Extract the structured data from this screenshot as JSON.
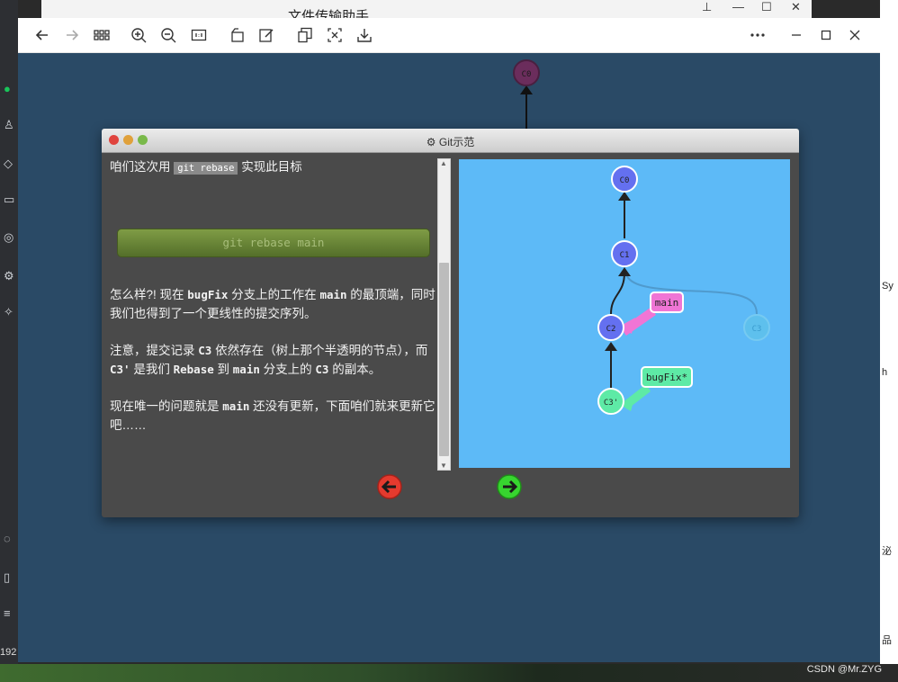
{
  "background": {
    "back_window_title": "文件传输助手",
    "right_edge_texts": [
      "Sy",
      "h",
      "泌",
      "品"
    ],
    "left_edge_text": "192",
    "watermark": "CSDN @Mr.ZYG"
  },
  "viewer": {
    "toolbar": [
      "back-icon",
      "forward-icon",
      "grid-icon",
      "zoom-in-icon",
      "zoom-out-icon",
      "actual-size-icon",
      "rotate-icon",
      "edit-icon",
      "copy-icon",
      "crop-icon",
      "save-icon",
      "more-icon",
      "minimize-icon",
      "maximize-icon",
      "close-icon"
    ]
  },
  "outer_tree": {
    "root_label": "C0"
  },
  "dialog": {
    "title": "Git示范",
    "colors": {
      "close": "#e0443e",
      "minimize": "#e0a13b",
      "zoom": "#79b94a"
    },
    "intro_prefix": "咱们这次用",
    "intro_badge": "git rebase",
    "intro_suffix": "实现此目标",
    "command": "git rebase main",
    "p1": {
      "a": "怎么样?! 现在 ",
      "b": "bugFix",
      "c": " 分支上的工作在 ",
      "d": "main",
      "e": " 的最顶端，同时我们也得到了一个更线性的提交序列。"
    },
    "p2": {
      "a": "注意，提交记录 ",
      "b": "C3",
      "c": " 依然存在（树上那个半透明的节点），而 ",
      "d": "C3'",
      "e": " 是我们 ",
      "f": "Rebase",
      "g": " 到 ",
      "h": "main",
      "i": " 分支上的 ",
      "j": "C3",
      "k": " 的副本。"
    },
    "p3": {
      "a": "现在唯一的问题就是 ",
      "b": "main",
      "c": " 还没有更新，下面咱们就来更新它吧……"
    }
  },
  "git_tree": {
    "commits": [
      "C0",
      "C1",
      "C2",
      "C3",
      "C3'"
    ],
    "branches": [
      {
        "name": "main",
        "target": "C2",
        "color": "#f075d5"
      },
      {
        "name": "bugFix*",
        "target": "C3'",
        "color": "#5eeaa6"
      }
    ],
    "colors": {
      "commit": "#6470f0",
      "head": "#5eeaa6",
      "ghost": "#5fc2ea",
      "bg": "#5dbaf7"
    }
  },
  "nav": {
    "prev_color": "#e53a2e",
    "next_color": "#37d52f"
  }
}
